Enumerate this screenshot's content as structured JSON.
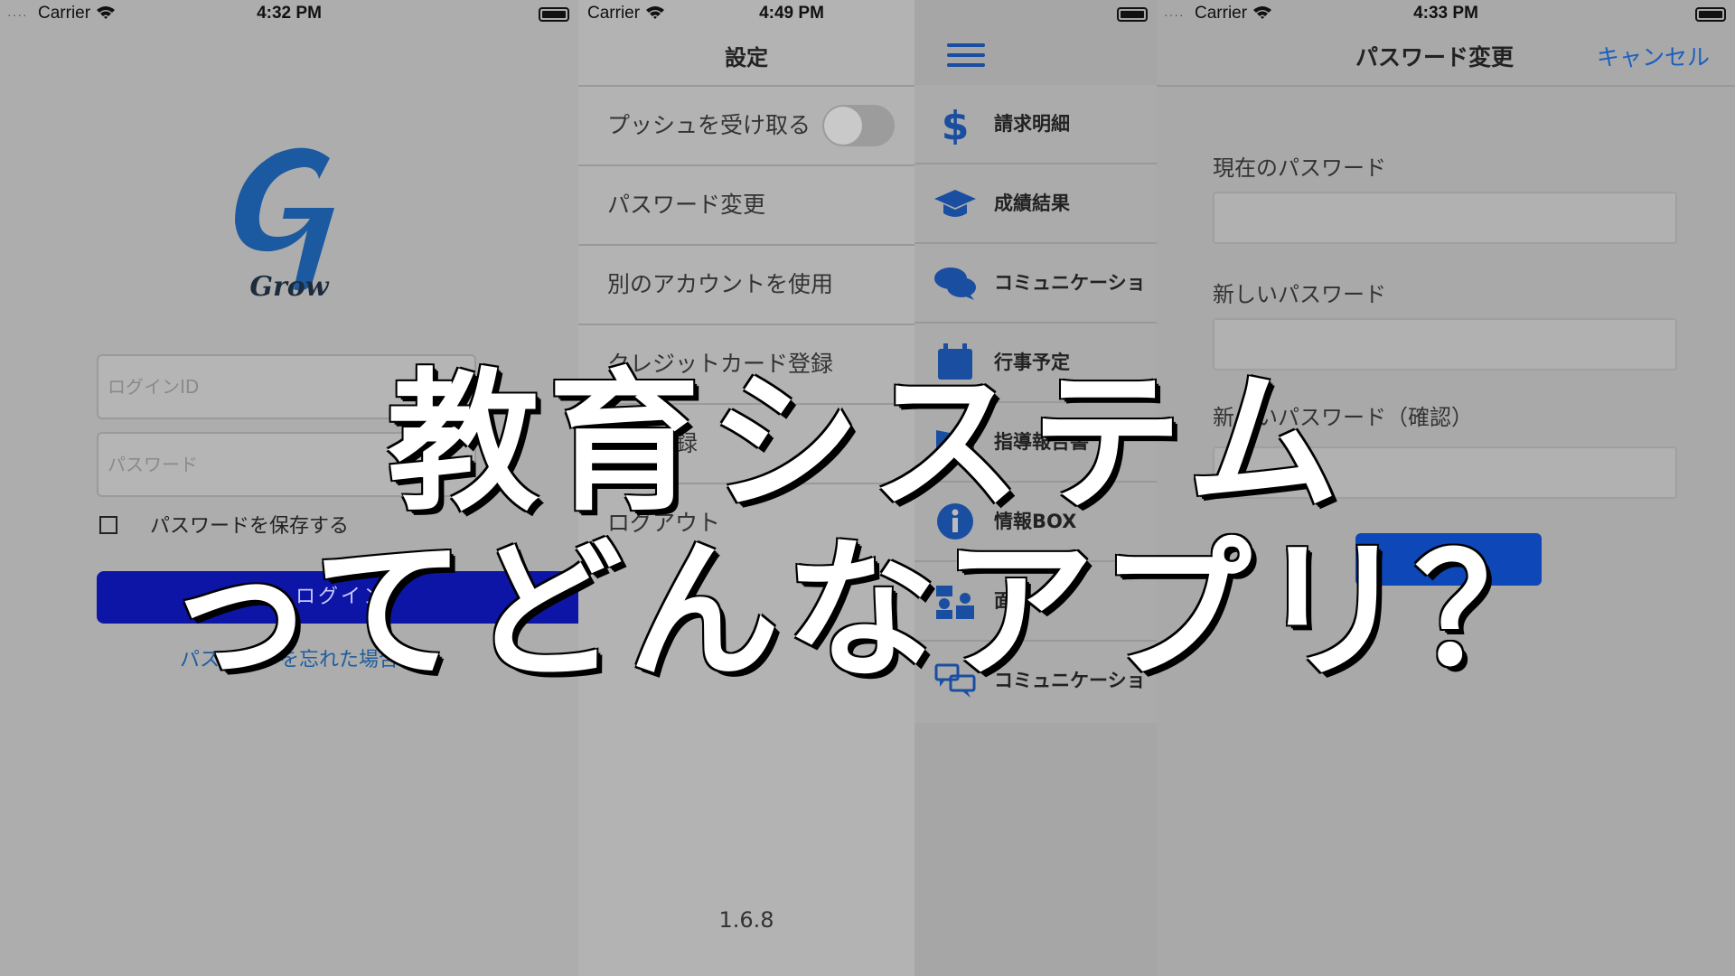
{
  "panel_login": {
    "status": {
      "carrier": "Carrier",
      "time": "4:32 PM"
    },
    "logo_text": "Grow",
    "login_id_placeholder": "ログインID",
    "password_placeholder": "パスワード",
    "remember_label": "パスワードを保存する",
    "login_button": "ログイン",
    "forgot_link": "パスワードを忘れた場合"
  },
  "panel_settings": {
    "status": {
      "carrier": "Carrier",
      "time": "4:49 PM"
    },
    "title": "設定",
    "rows": [
      {
        "label": "プッシュを受け取る"
      },
      {
        "label": "パスワード変更"
      },
      {
        "label": "別のアカウントを使用"
      },
      {
        "label": "クレジットカード登録"
      },
      {
        "label": "口座登録"
      },
      {
        "label": "ログアウト"
      }
    ],
    "version": "1.6.8"
  },
  "panel_menu": {
    "items": [
      {
        "label": "請求明細",
        "icon": "dollar-icon"
      },
      {
        "label": "成績結果",
        "icon": "graduation-cap-icon"
      },
      {
        "label": "コミュニケーショ",
        "icon": "chat-bubbles-icon"
      },
      {
        "label": "行事予定",
        "icon": "calendar-icon"
      },
      {
        "label": "指導報告書",
        "icon": "book-icon"
      },
      {
        "label": "情報BOX",
        "icon": "info-icon"
      },
      {
        "label": "面",
        "icon": "people-icon"
      },
      {
        "label": "コミュニケーショ",
        "icon": "comments-icon"
      }
    ]
  },
  "panel_password": {
    "status": {
      "carrier": "Carrier",
      "time": "4:33 PM"
    },
    "title": "パスワード変更",
    "cancel": "キャンセル",
    "current_label": "現在のパスワード",
    "new_label": "新しいパスワード",
    "confirm_label": "新しいパスワード（確認）",
    "submit": "変更"
  },
  "overlay": {
    "line1": "教育システム",
    "line2": "ってどんなアプリ？"
  },
  "colors": {
    "accent": "#1a5fc0",
    "login_button": "#0c15a6"
  }
}
